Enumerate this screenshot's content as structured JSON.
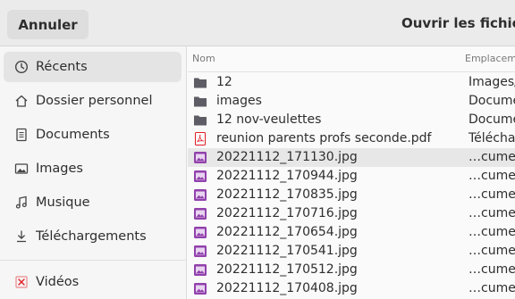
{
  "header": {
    "cancel_label": "Annuler",
    "title": "Ouvrir les fichiers"
  },
  "sidebar": {
    "items": [
      {
        "label": "Récents",
        "icon": "clock-icon"
      },
      {
        "label": "Dossier personnel",
        "icon": "home-icon"
      },
      {
        "label": "Documents",
        "icon": "document-icon"
      },
      {
        "label": "Images",
        "icon": "image-icon"
      },
      {
        "label": "Musique",
        "icon": "music-icon"
      },
      {
        "label": "Téléchargements",
        "icon": "download-icon"
      },
      {
        "label": "Vidéos",
        "icon": "video-icon"
      }
    ]
  },
  "file_list": {
    "columns": {
      "name": "Nom",
      "location": "Emplacem"
    },
    "rows": [
      {
        "name": "12",
        "location": "Images/",
        "type": "folder"
      },
      {
        "name": "images",
        "location": "Docume",
        "type": "folder"
      },
      {
        "name": "12 nov-veulettes",
        "location": "Docume",
        "type": "folder"
      },
      {
        "name": "reunion parents profs seconde.pdf",
        "location": "Téléchar",
        "type": "pdf"
      },
      {
        "name": "20221112_171130.jpg",
        "location": "…cume",
        "type": "image"
      },
      {
        "name": "20221112_170944.jpg",
        "location": "…cume",
        "type": "image"
      },
      {
        "name": "20221112_170835.jpg",
        "location": "…cume",
        "type": "image"
      },
      {
        "name": "20221112_170716.jpg",
        "location": "…cume",
        "type": "image"
      },
      {
        "name": "20221112_170654.jpg",
        "location": "…cume",
        "type": "image"
      },
      {
        "name": "20221112_170541.jpg",
        "location": "…cume",
        "type": "image"
      },
      {
        "name": "20221112_170512.jpg",
        "location": "…cume",
        "type": "image"
      },
      {
        "name": "20221112_170408.jpg",
        "location": "…cume",
        "type": "image"
      }
    ]
  },
  "colors": {
    "folder": "#5e5c64",
    "image": "#9141ac",
    "pdf": "#e01b24",
    "selection": "#e7e7e7"
  }
}
